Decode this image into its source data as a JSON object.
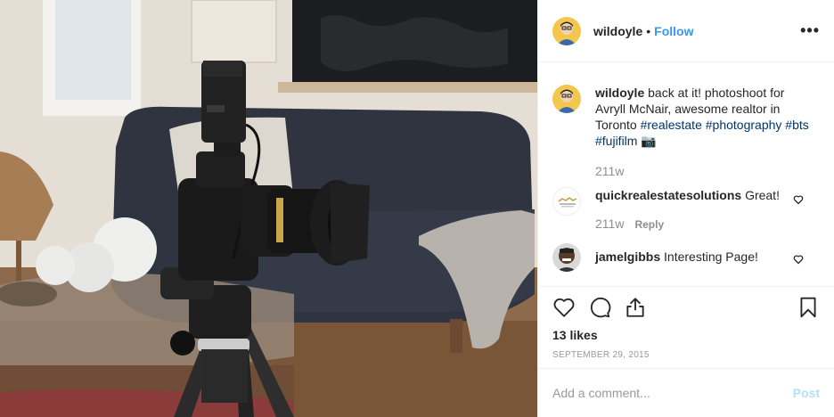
{
  "post": {
    "username": "wildoyle",
    "separator": "•",
    "follow_label": "Follow",
    "more_label": "•••",
    "caption": {
      "username": "wildoyle",
      "text": " back at it! photoshoot for Avryll McNair, awesome realtor in Toronto ",
      "hashtags": [
        "#realestate",
        "#photography",
        "#bts",
        "#fujifilm"
      ],
      "emoji": "📷",
      "time": "211w"
    },
    "comments": [
      {
        "username": "quickrealestatesolutions",
        "text": "Great!",
        "time": "211w",
        "reply_label": "Reply"
      },
      {
        "username": "jamelgibbs",
        "text": "Interesting Page!"
      }
    ],
    "likes": "13 likes",
    "date": "SEPTEMBER 29, 2015",
    "add_comment_placeholder": "Add a comment...",
    "post_label": "Post"
  },
  "icons": {
    "like": "heart-icon",
    "comment": "comment-icon",
    "share": "share-icon",
    "save": "bookmark-icon",
    "comment_like": "small-heart-icon"
  },
  "colors": {
    "link": "#3897f0",
    "hashtag": "#003569",
    "muted": "#8e8e8e",
    "post_disabled": "#b2dffc"
  }
}
